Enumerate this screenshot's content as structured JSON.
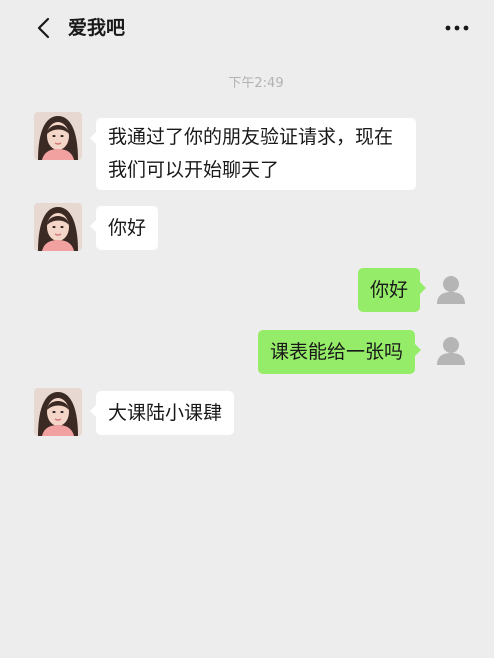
{
  "header": {
    "title": "爱我吧",
    "back_icon": "chevron-left-icon",
    "more_icon": "more-dots-icon"
  },
  "timestamp": "下午2:49",
  "colors": {
    "background": "#ededed",
    "bubble_incoming": "#ffffff",
    "bubble_outgoing": "#95ec69"
  },
  "messages": [
    {
      "side": "left",
      "text_lines": [
        "我通过了你的朋友验证请求，现在",
        "我们可以开始聊天了"
      ]
    },
    {
      "side": "left",
      "text": "你好"
    },
    {
      "side": "right",
      "text": "你好"
    },
    {
      "side": "right",
      "text": "课表能给一张吗"
    },
    {
      "side": "left",
      "text": "大课陆小课肆"
    }
  ]
}
